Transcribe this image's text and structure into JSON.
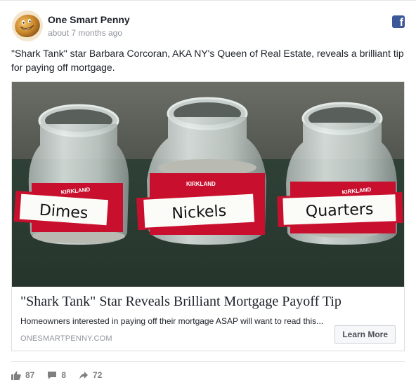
{
  "post": {
    "page_name": "One Smart Penny",
    "timestamp": "about 7 months ago",
    "text": "\"Shark Tank\" star Barbara Corcoran, AKA NY's Queen of Real Estate, reveals a brilliant tip for paying off mortgage.",
    "platform_icon": "facebook-icon"
  },
  "link": {
    "image_labels": {
      "brand": "KIRKLAND",
      "jar1": "Dimes",
      "jar2": "Nickels",
      "jar3": "Quarters"
    },
    "title": "\"Shark Tank\" Star Reveals Brilliant Mortgage Payoff Tip",
    "description": "Homeowners interested in paying off their mortgage ASAP will want to read this...",
    "domain": "ONESMARTPENNY.COM",
    "cta_label": "Learn More"
  },
  "stats": {
    "likes": "87",
    "comments": "8",
    "shares": "72"
  },
  "colors": {
    "facebook_blue": "#3b5998",
    "label_red": "#c8102e",
    "avatar_gold": "#c9862a"
  }
}
